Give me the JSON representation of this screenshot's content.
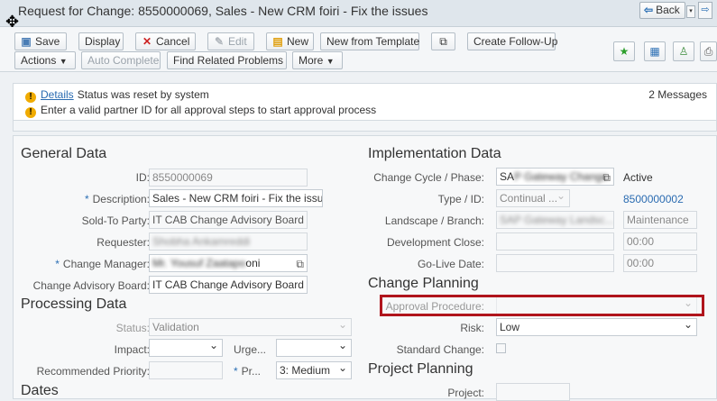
{
  "window": {
    "title": "Request for Change: 8550000069, Sales - New CRM foiri - Fix the issues",
    "back_label": "Back"
  },
  "toolbar": {
    "save": "Save",
    "display": "Display",
    "cancel": "Cancel",
    "edit": "Edit",
    "new": "New",
    "new_from_template": "New from Template",
    "create_follow_up": "Create Follow-Up",
    "actions": "Actions",
    "auto_complete": "Auto Complete",
    "find_related_problems": "Find Related Problems",
    "more": "More"
  },
  "messages": {
    "count": "2 Messages",
    "items": [
      {
        "link": "Details",
        "text": "Status was reset by system"
      },
      {
        "text": "Enter a valid partner ID for all approval steps to start approval process"
      }
    ]
  },
  "general_data": {
    "heading": "General Data",
    "id_label": "ID:",
    "id_value": "8550000069",
    "description_label": "Description:",
    "description_value": "Sales - New CRM foiri - Fix the issues",
    "sold_to_label": "Sold-To Party:",
    "sold_to_value": "IT CAB Change Advisory Board",
    "requester_label": "Requester:",
    "requester_value": "Shobha Ankamreddi",
    "change_manager_label": "Change Manager:",
    "change_manager_value_blur": "Mr. Yousuf Zaatapo",
    "change_manager_value": "oni",
    "cab_label": "Change Advisory Board:",
    "cab_value": "IT CAB Change Advisory Board"
  },
  "processing_data": {
    "heading": "Processing Data",
    "status_label": "Status:",
    "status_value": "Validation",
    "impact_label": "Impact:",
    "impact_value": "",
    "urgency_label": "Urge...",
    "urgency_value": "",
    "rec_priority_label": "Recommended Priority:",
    "rec_priority_value": "",
    "priority_label": "Pr...",
    "priority_value": "3: Medium"
  },
  "dates": {
    "heading": "Dates"
  },
  "implementation_data": {
    "heading": "Implementation Data",
    "cycle_label": "Change Cycle / Phase:",
    "cycle_value_prefix": "SA",
    "cycle_value_blur": "P Gateway Change",
    "phase_value": "Active",
    "type_label": "Type / ID:",
    "type_value": "Continual ...",
    "type_id": "8500000002",
    "landscape_label": "Landscape / Branch:",
    "landscape_value": "SAP Gateway Landsc...",
    "branch_value": "Maintenance",
    "dev_close_label": "Development Close:",
    "dev_close_time": "00:00",
    "golive_label": "Go-Live Date:",
    "golive_time": "00:00"
  },
  "change_planning": {
    "heading": "Change Planning",
    "approval_label": "Approval Procedure:",
    "approval_value": "",
    "risk_label": "Risk:",
    "risk_value": "Low",
    "standard_label": "Standard Change:"
  },
  "project_planning": {
    "heading": "Project Planning",
    "project_label": "Project:"
  },
  "colors": {
    "highlight": "#b0141c",
    "link": "#2a6bb1",
    "warning": "#f0ab00"
  }
}
